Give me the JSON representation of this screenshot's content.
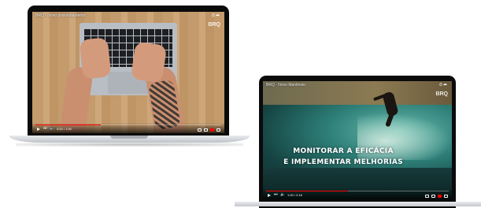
{
  "video1": {
    "title": "BRQ - Novo posicionamento",
    "watermark": "BRQ",
    "time": "0:00 / 1:00",
    "progress_fraction": 0.35,
    "top_icons": "⏱ ➦"
  },
  "video2": {
    "title": "BRQ - Novo Manifesto",
    "watermark": "BRQ",
    "time": "1:00 / 2:16",
    "progress_fraction": 0.45,
    "overlay_line1": "MONITORAR A EFICÁCIA",
    "overlay_line2": "E IMPLEMENTAR MELHORIAS",
    "top_icons": "⏱ ➦"
  },
  "colors": {
    "progress": "#ff0000",
    "bezel": "#0b0b0b",
    "laptop_silver": "#c4c8cc"
  }
}
